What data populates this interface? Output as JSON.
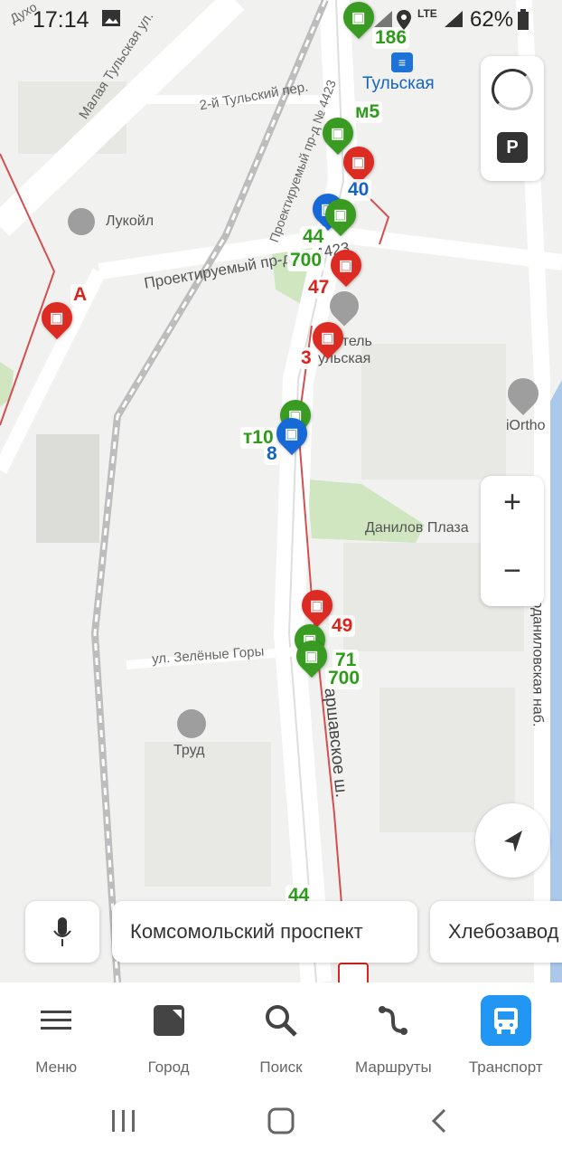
{
  "status": {
    "time": "17:14",
    "network": "LTE",
    "battery": "62%"
  },
  "map": {
    "station": {
      "name": "Тульская"
    },
    "places": {
      "lukoil": "Лукойл",
      "hotel": "Т Отель\nульская",
      "danilov_plaza": "Данилов Плаза",
      "iortho": "iOrtho",
      "trud": "Труд"
    },
    "streets": {
      "malaya_tulskaya": "Малая Тульская ул.",
      "tulsky_2": "2-й Тульский пер.",
      "proezd_4423": "Проектируемый пр-д № 4423",
      "proezd_4423_b": "Проектируемый пр-д № 4423",
      "zelenye_gory": "ул. Зелёные Горы",
      "varshavskoe": "аршавское ш.",
      "novodanilovskaya": "Новоданиловская наб.",
      "dukh": "Духо"
    },
    "routes": [
      {
        "label": "186",
        "kind": "bus"
      },
      {
        "label": "м5",
        "kind": "bus"
      },
      {
        "label": "40",
        "kind": "tram"
      },
      {
        "label": "44",
        "kind": "bus"
      },
      {
        "label": "700",
        "kind": "bus"
      },
      {
        "label": "47",
        "kind": "tram"
      },
      {
        "label": "A",
        "kind": "tram"
      },
      {
        "label": "3",
        "kind": "tram"
      },
      {
        "label": "т10",
        "kind": "bus"
      },
      {
        "label": "8",
        "kind": "trolley"
      },
      {
        "label": "49",
        "kind": "tram"
      },
      {
        "label": "71",
        "kind": "bus"
      },
      {
        "label": "700",
        "kind": "bus"
      },
      {
        "label": "44",
        "kind": "bus"
      }
    ],
    "controls": {
      "zoom_in": "+",
      "zoom_out": "−",
      "parking": "P"
    }
  },
  "suggestions": [
    {
      "label": "Комсомольский проспект"
    },
    {
      "label": "Хлебозавод"
    }
  ],
  "tabbar": [
    {
      "label": "Меню",
      "icon": "menu-icon"
    },
    {
      "label": "Город",
      "icon": "city-icon"
    },
    {
      "label": "Поиск",
      "icon": "search-icon"
    },
    {
      "label": "Маршруты",
      "icon": "routes-icon"
    },
    {
      "label": "Транспорт",
      "icon": "transport-icon",
      "active": true
    }
  ],
  "colors": {
    "accent": "#2196f3",
    "bus": "#3a9b22",
    "tram": "#dc2b22",
    "trolley": "#1669d6"
  }
}
